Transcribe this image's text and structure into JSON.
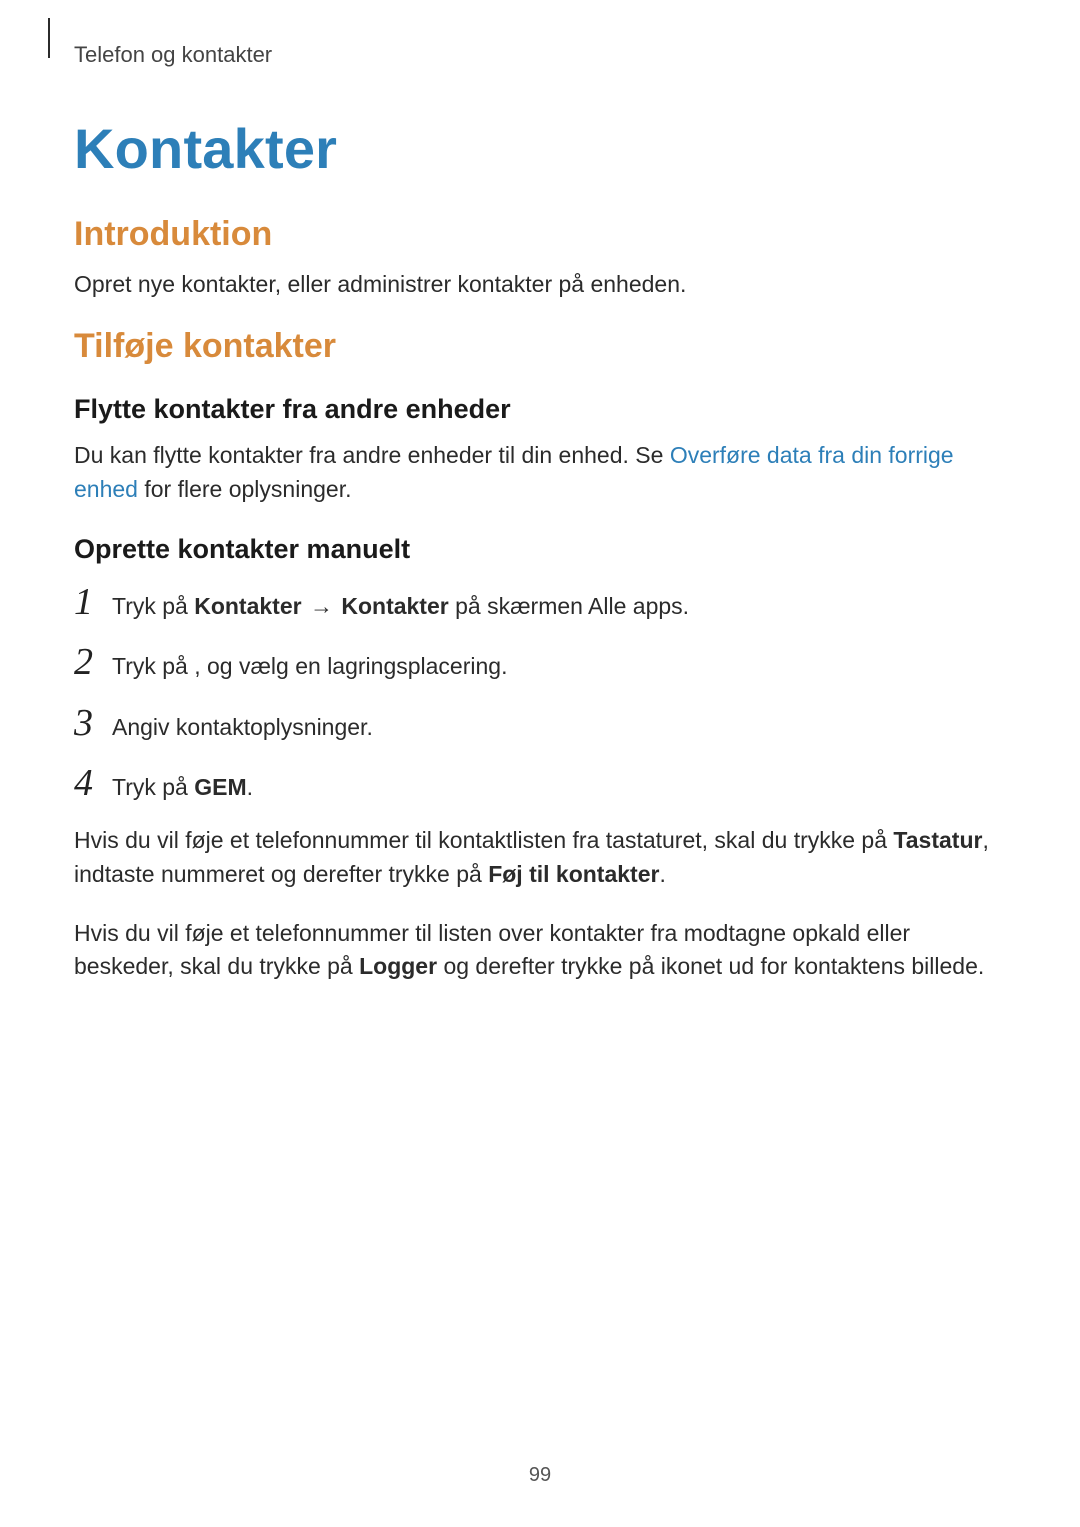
{
  "breadcrumb": "Telefon og kontakter",
  "title": "Kontakter",
  "intro": {
    "heading": "Introduktion",
    "body": "Opret nye kontakter, eller administrer kontakter på enheden."
  },
  "add": {
    "heading": "Tilføje kontakter",
    "sub1": {
      "heading": "Flytte kontakter fra andre enheder",
      "body_pre": "Du kan flytte kontakter fra andre enheder til din enhed. Se ",
      "link_text": "Overføre data fra din forrige enhed",
      "body_post": " for flere oplysninger."
    },
    "sub2": {
      "heading": "Oprette kontakter manuelt",
      "steps": [
        {
          "pre": "Tryk på ",
          "bold1": "Kontakter",
          "arrow": " → ",
          "bold2": "Kontakter",
          "post": " på skærmen Alle apps."
        },
        {
          "pre": "Tryk på ",
          "icon_gap": "   ",
          "post": ", og vælg en lagringsplacering."
        },
        {
          "pre": "Angiv kontaktoplysninger."
        },
        {
          "pre": "Tryk på ",
          "bold1": "GEM",
          "post": "."
        }
      ],
      "note1_pre": "Hvis du vil føje et telefonnummer til kontaktlisten fra tastaturet, skal du trykke på ",
      "note1_b1": "Tastatur",
      "note1_mid": ", indtaste nummeret og derefter trykke på ",
      "note1_b2": "Føj til kontakter",
      "note1_post": ".",
      "note2_pre": "Hvis du vil føje et telefonnummer til listen over kontakter fra modtagne opkald eller beskeder, skal du trykke på ",
      "note2_b1": "Logger",
      "note2_post": " og derefter trykke på ikonet ud for kontaktens billede."
    }
  },
  "page_number": "99"
}
